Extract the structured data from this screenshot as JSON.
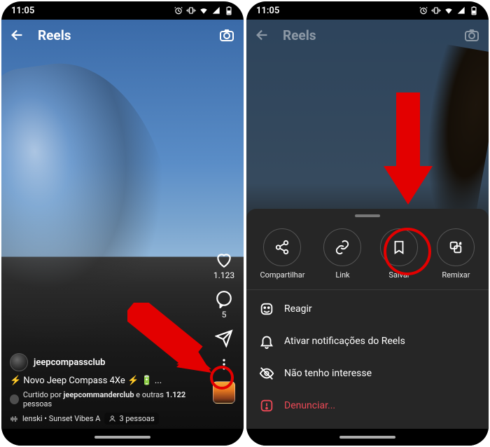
{
  "status": {
    "time": "11:05"
  },
  "header": {
    "title": "Reels"
  },
  "left": {
    "likes": "1.123",
    "comments": "5",
    "username": "jeepcompassclub",
    "caption_prefix": "⚡ ",
    "caption": "Novo Jeep Compass 4Xe",
    "caption_suffix": " ⚡ 🔋 ...",
    "liked_by_prefix": "Curtido por ",
    "liked_by_user": "jeepcommanderclub",
    "liked_by_middle": " e outras ",
    "liked_by_count": "1.122",
    "liked_by_suffix": " pessoas",
    "audio_artist": "lenski",
    "audio_dot": " • ",
    "audio_track": "Sunset Vibes",
    "audio_trail": "   A",
    "tagged_people": "3 pessoas"
  },
  "sheet": {
    "share": "Compartilhar",
    "link": "Link",
    "save": "Salvar",
    "remix": "Remixar",
    "react": "Reagir",
    "notifications": "Ativar notificações do Reels",
    "not_interested": "Não tenho interesse",
    "report": "Denunciar..."
  }
}
